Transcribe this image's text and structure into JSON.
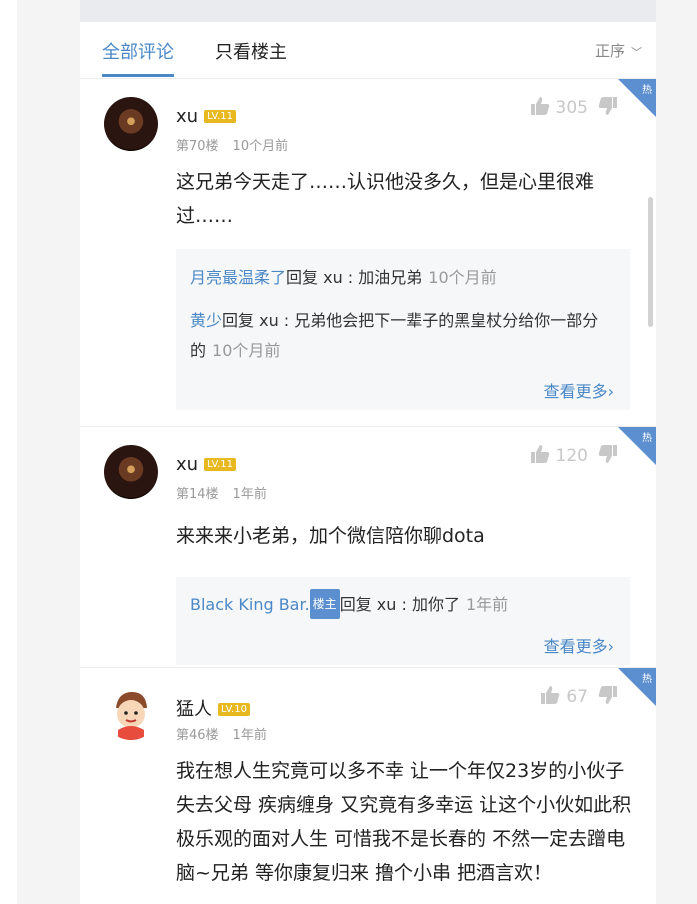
{
  "tabs": {
    "all": "全部评论",
    "op_only": "只看楼主",
    "sort": "正序"
  },
  "hot_label": "热",
  "comments": [
    {
      "user": "xu",
      "level": "LV.11",
      "floor": "第70楼",
      "time": "10个月前",
      "likes": "305",
      "text": "这兄弟今天走了……认识他没多久，但是心里很难过……",
      "replies": [
        {
          "name": "月亮最温柔了",
          "action": "回复 xu : 加油兄弟",
          "time": "10个月前"
        },
        {
          "name": "黄少",
          "action": "回复 xu : 兄弟他会把下一辈子的黑皇杖分给你一部分的",
          "time": "10个月前"
        }
      ],
      "more": "查看更多"
    },
    {
      "user": "xu",
      "level": "LV.11",
      "floor": "第14楼",
      "time": "1年前",
      "likes": "120",
      "text": "来来来小老弟，加个微信陪你聊dota",
      "replies": [
        {
          "name": "Black King Bar.",
          "badge": "楼主",
          "action": "回复 xu : 加你了",
          "time": "1年前"
        }
      ],
      "more": "查看更多"
    },
    {
      "user": "猛人",
      "level": "LV.10",
      "floor": "第46楼",
      "time": "1年前",
      "likes": "67",
      "text": "我在想人生究竟可以多不幸 让一个年仅23岁的小伙子失去父母 疾病缠身 又究竟有多幸运 让这个小伙如此积极乐观的面对人生 可惜我不是长春的 不然一定去蹭电脑~兄弟 等你康复归来 撸个小串 把酒言欢！"
    }
  ]
}
